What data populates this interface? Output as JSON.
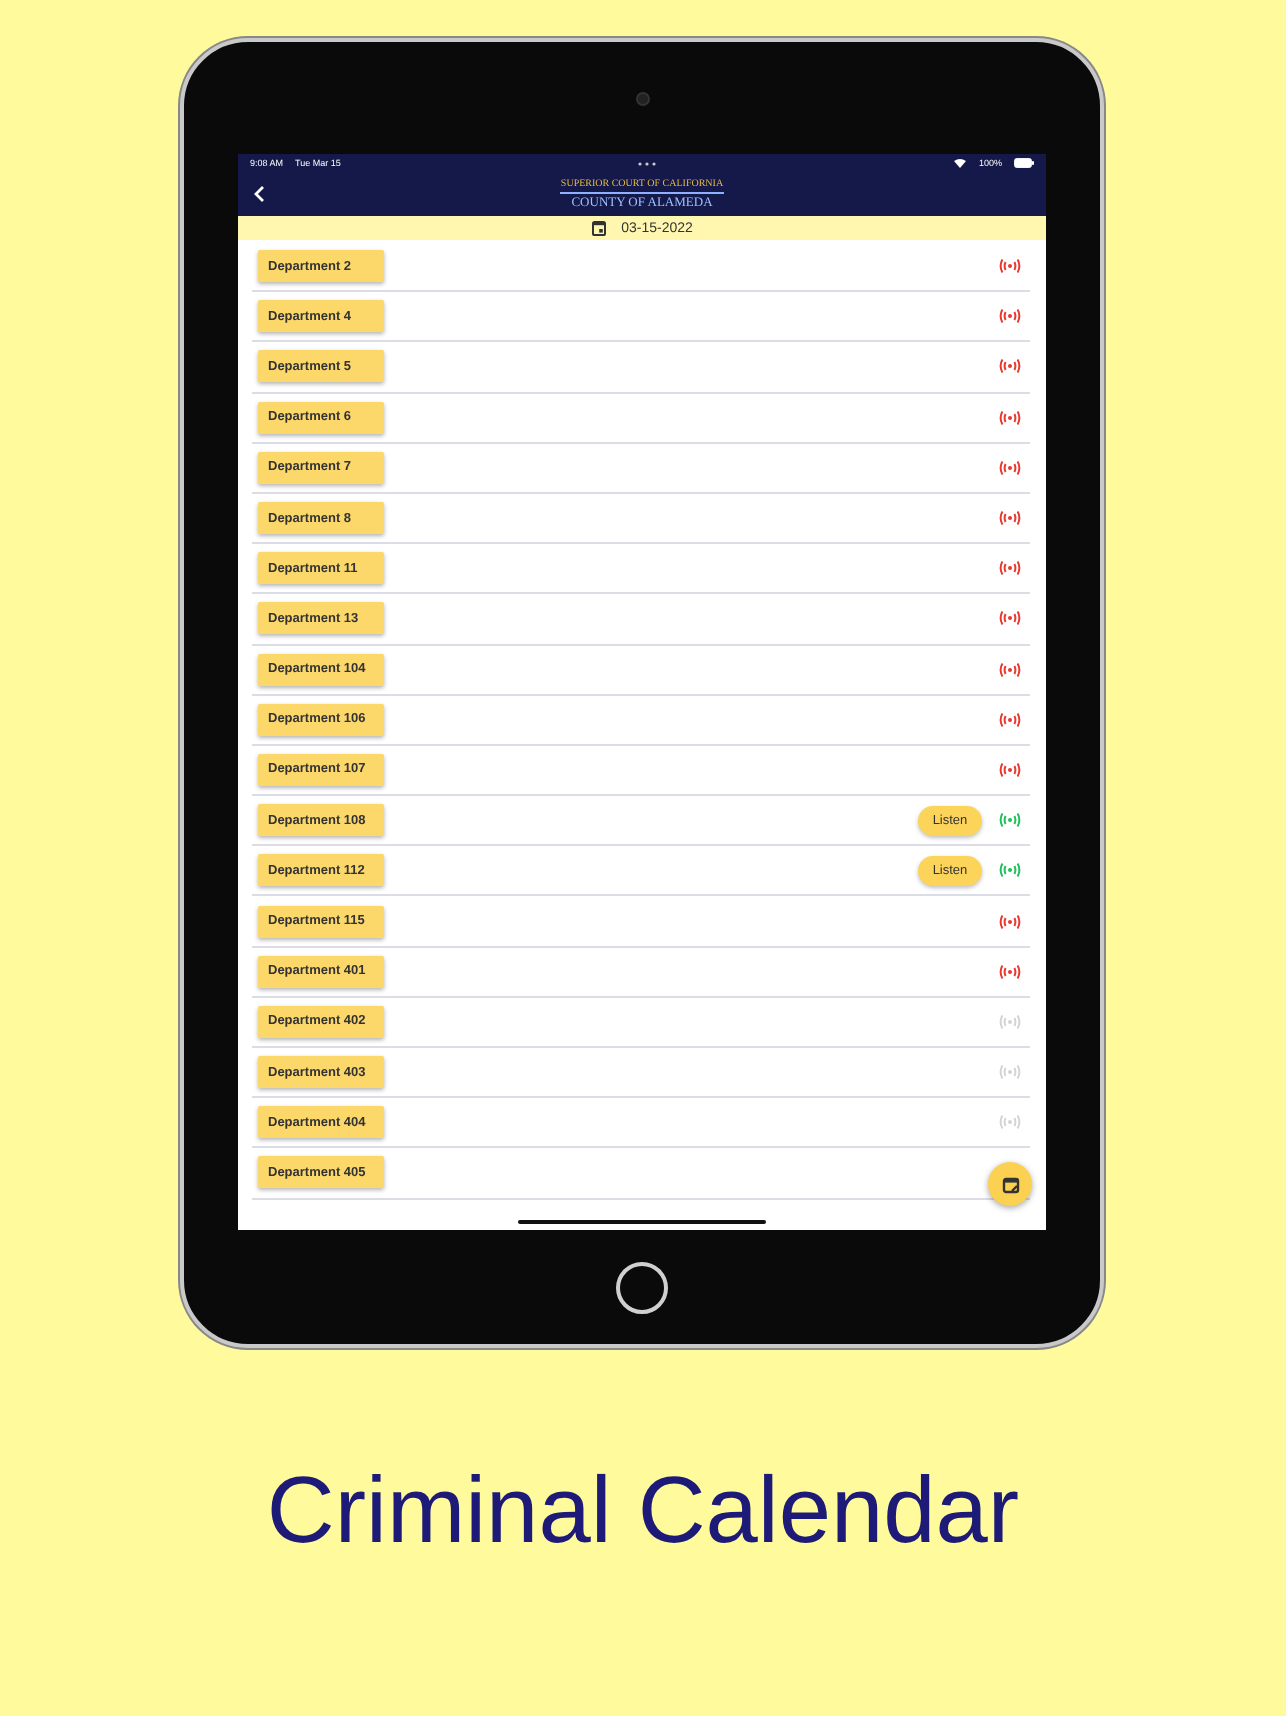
{
  "status_bar": {
    "time": "9:08 AM",
    "date": "Tue Mar 15",
    "battery": "100%"
  },
  "header": {
    "title": "SUPERIOR COURT OF CALIFORNIA",
    "subtitle": "COUNTY OF ALAMEDA"
  },
  "date_bar": {
    "date": "03-15-2022"
  },
  "departments": [
    {
      "name": "Department 2",
      "live": false,
      "disabled": false
    },
    {
      "name": "Department 4",
      "live": false,
      "disabled": false
    },
    {
      "name": "Department 5",
      "live": false,
      "disabled": false
    },
    {
      "name": "Department 6",
      "live": false,
      "disabled": false
    },
    {
      "name": "Department 7",
      "live": false,
      "disabled": false
    },
    {
      "name": "Department 8",
      "live": false,
      "disabled": false
    },
    {
      "name": "Department 11",
      "live": false,
      "disabled": false
    },
    {
      "name": "Department 13",
      "live": false,
      "disabled": false
    },
    {
      "name": "Department 104",
      "live": false,
      "disabled": false
    },
    {
      "name": "Department 106",
      "live": false,
      "disabled": false
    },
    {
      "name": "Department 107",
      "live": false,
      "disabled": false
    },
    {
      "name": "Department 108",
      "live": true,
      "disabled": false,
      "action": "Listen"
    },
    {
      "name": "Department 112",
      "live": true,
      "disabled": false,
      "action": "Listen"
    },
    {
      "name": "Department 115",
      "live": false,
      "disabled": false
    },
    {
      "name": "Department 401",
      "live": false,
      "disabled": false
    },
    {
      "name": "Department 402",
      "disabled": true
    },
    {
      "name": "Department 403",
      "disabled": true
    },
    {
      "name": "Department 404",
      "disabled": true
    },
    {
      "name": "Department 405"
    }
  ],
  "caption": "Criminal Calendar"
}
